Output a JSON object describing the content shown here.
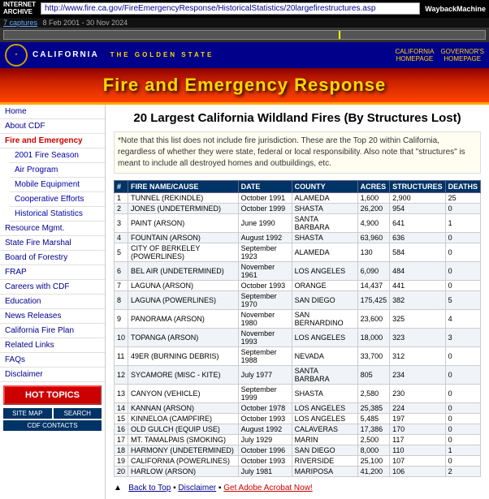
{
  "topbar": {
    "ia_logo": "INTERNET\nARCHIVE",
    "wayback_logo": "WaybackMachine",
    "url": "http://www.fire.ca.gov/FireEmergencyResponse/HistoricalStatistics/20largefirestructures.asp",
    "captures_link": "7 captures",
    "captures_dates": "8 Feb 2001 - 30 Nov 2024"
  },
  "ca_header": {
    "title": "CALIFORNIA",
    "subtitle": "THE GOLDEN STATE",
    "link1": "CALIFORNIA\nHOMEPAGE",
    "link2": "GOVERNOR'S\nHOMEPAGE"
  },
  "banner": {
    "title": "Fire and Emergency Response"
  },
  "sidebar": {
    "items": [
      {
        "label": "Home",
        "active": false
      },
      {
        "label": "About CDF",
        "active": false
      },
      {
        "label": "Fire and Emergency",
        "active": true
      },
      {
        "label": "2001 Fire Season",
        "active": false,
        "sub": true
      },
      {
        "label": "Air Program",
        "active": false,
        "sub": true
      },
      {
        "label": "Mobile Equipment",
        "active": false,
        "sub": true
      },
      {
        "label": "Cooperative Efforts",
        "active": false,
        "sub": true
      },
      {
        "label": "Historical Statistics",
        "active": false,
        "sub": true
      },
      {
        "label": "Resource Mgmt.",
        "active": false
      },
      {
        "label": "State Fire Marshal",
        "active": false
      },
      {
        "label": "Board of Forestry",
        "active": false
      },
      {
        "label": "FRAP",
        "active": false
      },
      {
        "label": "Careers with CDF",
        "active": false
      },
      {
        "label": "Education",
        "active": false
      },
      {
        "label": "News Releases",
        "active": false
      },
      {
        "label": "California Fire Plan",
        "active": false
      },
      {
        "label": "Related Links",
        "active": false
      },
      {
        "label": "FAQs",
        "active": false
      },
      {
        "label": "Disclaimer",
        "active": false
      }
    ],
    "hot_topics": "HOT TOPICS",
    "site_map": "SITE MAP",
    "search": "SEARCH",
    "cdf_contacts": "CDF CONTACTS"
  },
  "content": {
    "heading": "20 Largest California Wildland Fires (By Structures Lost)",
    "note": "*Note that this list does not include fire jurisdiction. These are the Top 20 within California, regardless of whether they were state, federal or local responsibility. Also note that \"structures\" is meant to include all destroyed homes and outbuildings, etc.",
    "table_headers": [
      "#",
      "FIRE NAME/CAUSE",
      "DATE",
      "COUNTY",
      "ACRES",
      "STRUCTURES",
      "DEATHS"
    ],
    "fires": [
      {
        "num": "1",
        "name": "TUNNEL (REKINDLE)",
        "date": "October 1991",
        "county": "ALAMEDA",
        "acres": "1,600",
        "structures": "2,900",
        "deaths": "25"
      },
      {
        "num": "2",
        "name": "JONES (UNDETERMINED)",
        "date": "October 1999",
        "county": "SHASTA",
        "acres": "26,200",
        "structures": "954",
        "deaths": "0"
      },
      {
        "num": "3",
        "name": "PAINT (ARSON)",
        "date": "June 1990",
        "county": "SANTA BARBARA",
        "acres": "4,900",
        "structures": "641",
        "deaths": "1"
      },
      {
        "num": "4",
        "name": "FOUNTAIN (ARSON)",
        "date": "August 1992",
        "county": "SHASTA",
        "acres": "63,960",
        "structures": "636",
        "deaths": "0"
      },
      {
        "num": "5",
        "name": "CITY OF BERKELEY (POWERLINES)",
        "date": "September 1923",
        "county": "ALAMEDA",
        "acres": "130",
        "structures": "584",
        "deaths": "0"
      },
      {
        "num": "6",
        "name": "BEL AIR (UNDETERMINED)",
        "date": "November 1961",
        "county": "LOS ANGELES",
        "acres": "6,090",
        "structures": "484",
        "deaths": "0"
      },
      {
        "num": "7",
        "name": "LAGUNA (ARSON)",
        "date": "October 1993",
        "county": "ORANGE",
        "acres": "14,437",
        "structures": "441",
        "deaths": "0"
      },
      {
        "num": "8",
        "name": "LAGUNA (POWERLINES)",
        "date": "September 1970",
        "county": "SAN DIEGO",
        "acres": "175,425",
        "structures": "382",
        "deaths": "5"
      },
      {
        "num": "9",
        "name": "PANORAMA (ARSON)",
        "date": "November 1980",
        "county": "SAN BERNARDINO",
        "acres": "23,600",
        "structures": "325",
        "deaths": "4"
      },
      {
        "num": "10",
        "name": "TOPANGA (ARSON)",
        "date": "November 1993",
        "county": "LOS ANGELES",
        "acres": "18,000",
        "structures": "323",
        "deaths": "3"
      },
      {
        "num": "11",
        "name": "49ER (BURNING DEBRIS)",
        "date": "September 1988",
        "county": "NEVADA",
        "acres": "33,700",
        "structures": "312",
        "deaths": "0"
      },
      {
        "num": "12",
        "name": "SYCAMORE (MISC - KITE)",
        "date": "July 1977",
        "county": "SANTA BARBARA",
        "acres": "805",
        "structures": "234",
        "deaths": "0"
      },
      {
        "num": "13",
        "name": "CANYON (VEHICLE)",
        "date": "September 1999",
        "county": "SHASTA",
        "acres": "2,580",
        "structures": "230",
        "deaths": "0"
      },
      {
        "num": "14",
        "name": "KANNAN (ARSON)",
        "date": "October 1978",
        "county": "LOS ANGELES",
        "acres": "25,385",
        "structures": "224",
        "deaths": "0"
      },
      {
        "num": "15",
        "name": "KINNELOA (CAMPFIRE)",
        "date": "October 1993",
        "county": "LOS ANGELES",
        "acres": "5,485",
        "structures": "197",
        "deaths": "0"
      },
      {
        "num": "16",
        "name": "OLD GULCH (EQUIP USE)",
        "date": "August 1992",
        "county": "CALAVERAS",
        "acres": "17,386",
        "structures": "170",
        "deaths": "0"
      },
      {
        "num": "17",
        "name": "MT. TAMALPAIS (SMOKING)",
        "date": "July 1929",
        "county": "MARIN",
        "acres": "2,500",
        "structures": "117",
        "deaths": "0"
      },
      {
        "num": "18",
        "name": "HARMONY (UNDETERMINED)",
        "date": "October 1996",
        "county": "SAN DIEGO",
        "acres": "8,000",
        "structures": "110",
        "deaths": "1"
      },
      {
        "num": "19",
        "name": "CALIFORNIA (POWERLINES)",
        "date": "October 1993",
        "county": "RIVERSIDE",
        "acres": "25,100",
        "structures": "107",
        "deaths": "0"
      },
      {
        "num": "20",
        "name": "HARLOW (ARSON)",
        "date": "July 1981",
        "county": "MARIPOSA",
        "acres": "41,200",
        "structures": "106",
        "deaths": "2"
      }
    ],
    "footer": {
      "back_to_top": "Back to Top",
      "disclaimer": "Disclaimer",
      "acrobat": "Get Adobe Acrobat Now!"
    }
  }
}
